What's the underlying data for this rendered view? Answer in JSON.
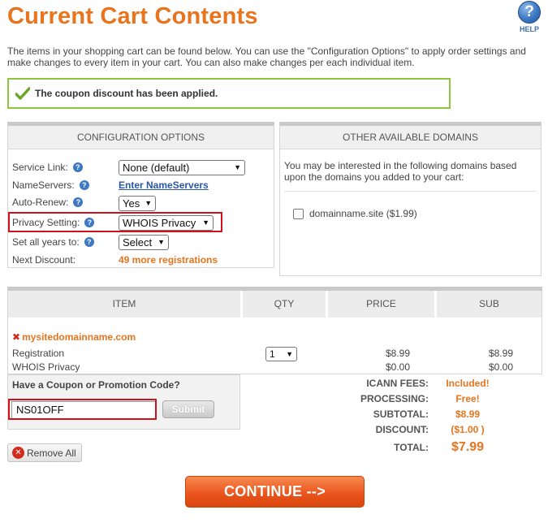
{
  "page": {
    "title": "Current Cart Contents",
    "help_label": "HELP",
    "intro": "The items in your shopping cart can be found below. You can use the \"Configuration Options\" to apply order settings and make changes to every item in your cart. You can also make changes per each individual item."
  },
  "coupon_message": "The coupon discount has been applied.",
  "config": {
    "heading": "CONFIGURATION OPTIONS",
    "service_link": {
      "label": "Service Link:",
      "value": "None (default)"
    },
    "nameservers": {
      "label": "NameServers:",
      "link": "Enter NameServers"
    },
    "auto_renew": {
      "label": "Auto-Renew:",
      "value": "Yes"
    },
    "privacy": {
      "label": "Privacy Setting:",
      "value": "WHOIS Privacy"
    },
    "years": {
      "label": "Set all years to:",
      "value": "Select"
    },
    "next_discount": {
      "label": "Next Discount:",
      "value": "49 more registrations"
    }
  },
  "domains": {
    "heading": "OTHER AVAILABLE DOMAINS",
    "text": "You may be interested in the following domains based upon the domains you added to your cart:",
    "option": "domainname.site ($1.99)"
  },
  "cart": {
    "columns": [
      "ITEM",
      "QTY",
      "PRICE",
      "SUB"
    ],
    "item_name": "mysitedomainname.com",
    "lines": [
      {
        "label": "Registration",
        "price": "$8.99",
        "sub": "$8.99",
        "qty": "1"
      },
      {
        "label": "WHOIS Privacy",
        "price": "$0.00",
        "sub": "$0.00"
      }
    ]
  },
  "promo": {
    "title": "Have a Coupon or Promotion Code?",
    "code": "NS01OFF",
    "submit": "Submit"
  },
  "totals": [
    {
      "label": "ICANN FEES:",
      "value": "Included!"
    },
    {
      "label": "PROCESSING:",
      "value": "Free!"
    },
    {
      "label": "SUBTOTAL:",
      "value": "$8.99"
    },
    {
      "label": "DISCOUNT:",
      "value": "($1.00 )"
    },
    {
      "label": "TOTAL:",
      "value": "$7.99"
    }
  ],
  "actions": {
    "remove_all": "Remove All",
    "continue": "CONTINUE -->"
  },
  "colors": {
    "accent_orange": "#e8741e",
    "highlight_red": "#d0101a",
    "success_green": "#8cc63f",
    "link_blue": "#2a56a8"
  }
}
